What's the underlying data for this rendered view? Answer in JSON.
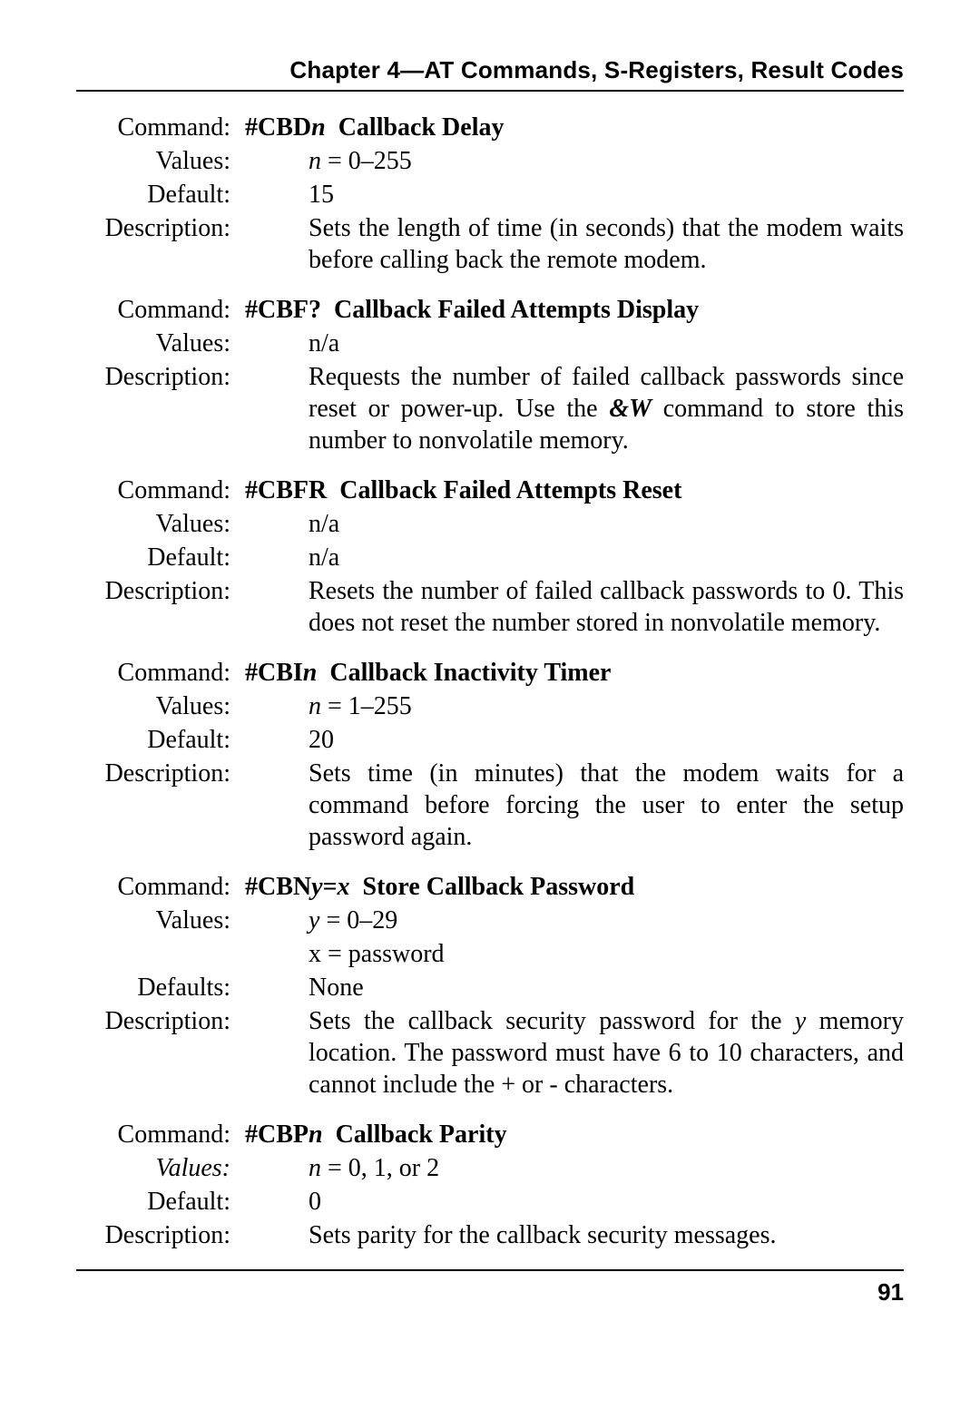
{
  "header": "Chapter 4—AT Commands, S-Registers, Result Codes",
  "page_number": "91",
  "blocks": [
    {
      "cmd_label": "Command:",
      "cmd_prefix": "#CBD",
      "cmd_var": "n",
      "cmd_suffix": "",
      "cmd_title": "Callback Delay",
      "rows": [
        {
          "label": "Values:",
          "value_pre": "n",
          "value_post": " = 0–255",
          "italic_pre": true
        },
        {
          "label": "Default:",
          "value": "15"
        }
      ],
      "desc_label": "Description:",
      "desc": "Sets the length of time (in seconds) that the modem waits before calling back the remote modem."
    },
    {
      "cmd_label": "Command:",
      "cmd_prefix": "#CBF?",
      "cmd_var": "",
      "cmd_suffix": "",
      "cmd_title": "Callback Failed Attempts Display",
      "rows": [
        {
          "label": "Values:",
          "value": "n/a"
        }
      ],
      "desc_label": "Description:",
      "desc_parts": [
        "Requests the number of failed callback passwords since reset or power-up. Use the ",
        "&W",
        " command to store this number to nonvolatile memory."
      ]
    },
    {
      "cmd_label": "Command:",
      "cmd_prefix": "#CBFR",
      "cmd_var": "",
      "cmd_suffix": "",
      "cmd_title": "Callback Failed Attempts Reset",
      "rows": [
        {
          "label": "Values:",
          "value": "n/a"
        },
        {
          "label": "Default:",
          "value": "n/a"
        }
      ],
      "desc_label": "Description:",
      "desc": "Resets the number of failed callback passwords to 0. This does not reset the number stored in nonvolatile memory."
    },
    {
      "cmd_label": "Command:",
      "cmd_prefix": "#CBI",
      "cmd_var": "n",
      "cmd_suffix": "",
      "cmd_title": "Callback Inactivity Timer",
      "rows": [
        {
          "label": "Values:",
          "value_pre": "n",
          "value_post": " = 1–255",
          "italic_pre": true
        },
        {
          "label": "Default:",
          "value": "20"
        }
      ],
      "desc_label": "Description:",
      "desc": "Sets time (in minutes) that the modem waits for a command before forcing the  user to enter  the setup password again."
    },
    {
      "cmd_label": "Command:",
      "cmd_prefix": "#CBN",
      "cmd_var": "y=x",
      "cmd_suffix": "",
      "cmd_title": "Store Callback Password",
      "rows": [
        {
          "label": "Values:",
          "value_pre": "y",
          "value_post": " = 0–29",
          "italic_pre": true
        },
        {
          "label": "",
          "value": "x = password"
        },
        {
          "label": "Defaults:",
          "value": "None"
        }
      ],
      "desc_label": "Description:",
      "desc_parts2": [
        "Sets the callback security password for the ",
        "y",
        " memory location. The password must have 6 to 10 characters, and cannot include the + or - characters."
      ]
    },
    {
      "cmd_label": "Command:",
      "cmd_prefix": "#CBP",
      "cmd_var": "n",
      "cmd_suffix": "",
      "cmd_title": "Callback Parity",
      "rows": [
        {
          "label": "Values:",
          "label_italic": true,
          "value_pre": "n",
          "value_post": " = 0, 1, or 2",
          "italic_pre": true
        },
        {
          "label": "Default:",
          "value": "0"
        }
      ],
      "desc_label": "Description:",
      "desc": "Sets parity for the callback security messages.",
      "desc_no_justify": true
    }
  ]
}
